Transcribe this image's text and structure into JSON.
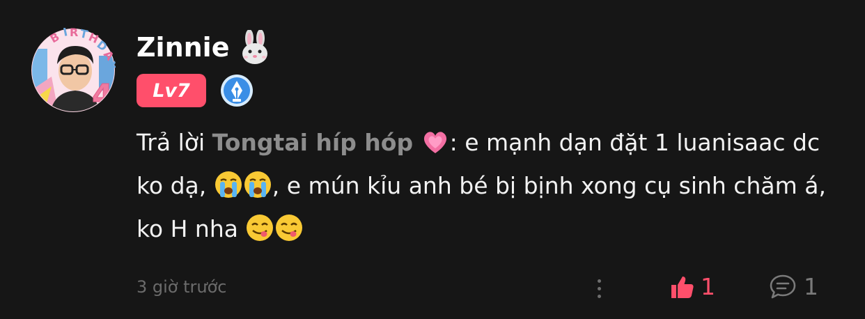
{
  "comment": {
    "username": "Zinnie",
    "username_emoji": "rabbit-face",
    "level_badge": "Lv7",
    "creator_badge_icon": "fountain-pen-icon",
    "reply_prefix": "Trả lời",
    "reply_to": "Tongtai híp hóp",
    "reply_to_emoji": "growing-heart",
    "text_1": ": e mạnh dạn đặt 1 luanisaac dc ko dạ,",
    "text_2": ", e mún kỉu anh bé bị bịnh xong cụ sinh chăm á, ko H nha",
    "timestamp": "3 giờ trước",
    "like_count": "1",
    "comment_count": "1"
  },
  "colors": {
    "background": "#161616",
    "accent": "#ff4f6b",
    "mention": "#8d8d8d",
    "muted": "#6b6b6b"
  }
}
